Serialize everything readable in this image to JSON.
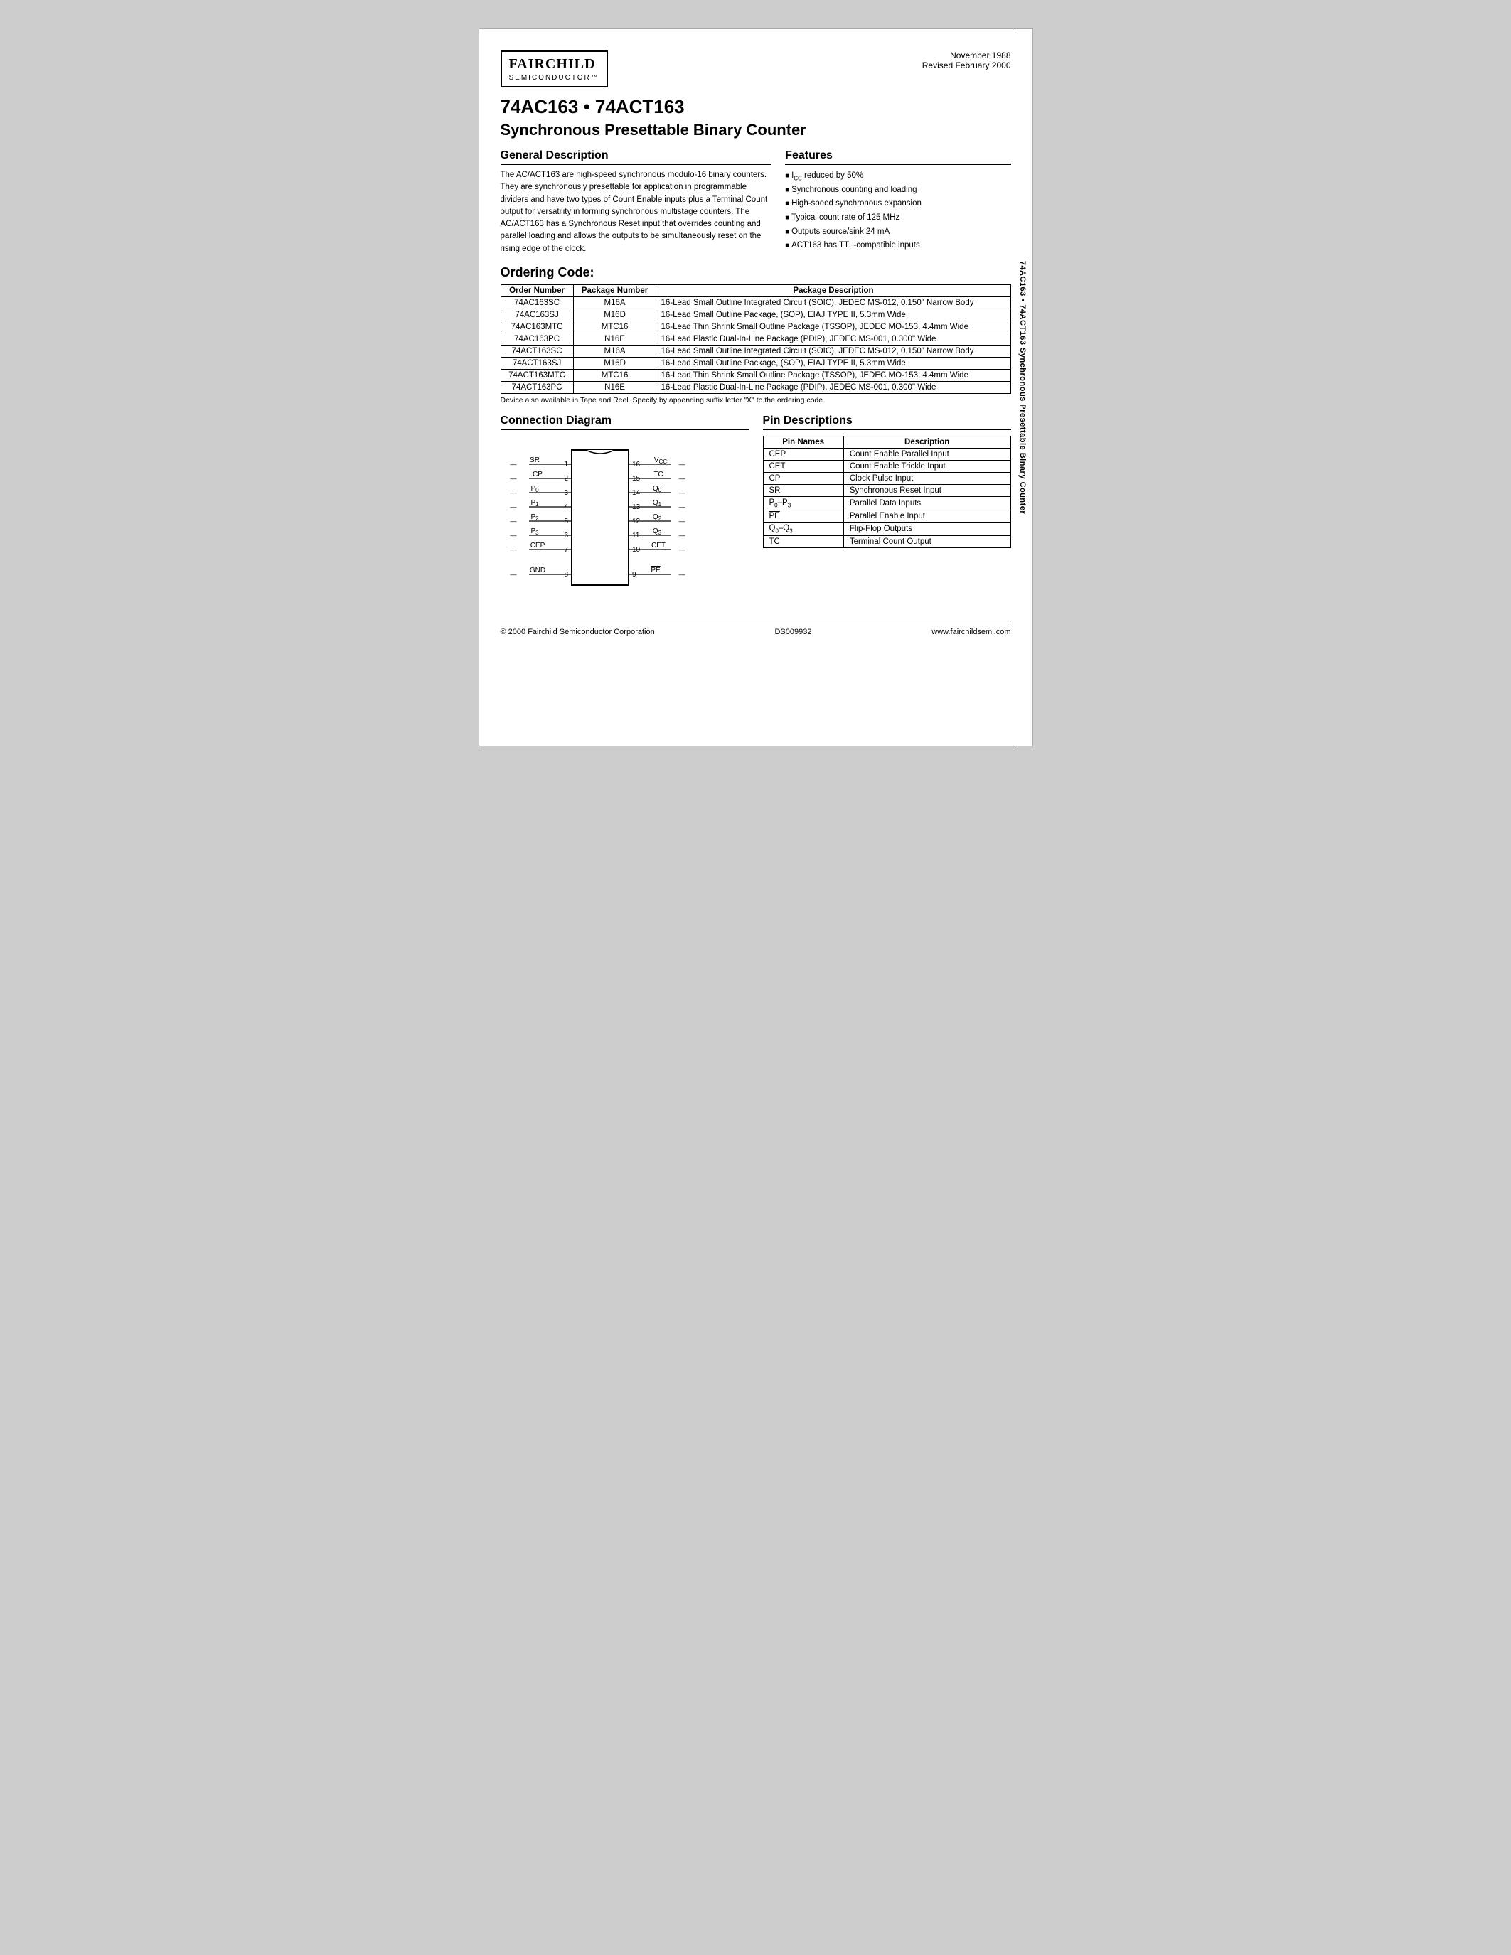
{
  "page": {
    "side_text": "74AC163 • 74ACT163 Synchronous Presettable Binary Counter",
    "date": "November 1988",
    "revised": "Revised February 2000",
    "logo": {
      "name": "FAIRCHILD",
      "sub": "SEMICONDUCTOR™"
    },
    "title": "74AC163 • 74ACT163",
    "subtitle": "Synchronous Presettable Binary Counter",
    "general_description": {
      "heading": "General Description",
      "text": "The AC/ACT163 are high-speed synchronous modulo-16 binary counters. They are synchronously presettable for application in programmable dividers and have two types of Count Enable inputs plus a Terminal Count output for versatility in forming synchronous multistage counters. The AC/ACT163 has a Synchronous Reset input that overrides counting and parallel loading and allows the outputs to be simultaneously reset on the rising edge of the clock."
    },
    "features": {
      "heading": "Features",
      "items": [
        "I_CC reduced by 50%",
        "Synchronous counting and loading",
        "High-speed synchronous expansion",
        "Typical count rate of 125 MHz",
        "Outputs source/sink 24 mA",
        "ACT163 has TTL-compatible inputs"
      ]
    },
    "ordering": {
      "heading": "Ordering Code:",
      "columns": [
        "Order Number",
        "Package Number",
        "Package Description"
      ],
      "rows": [
        [
          "74AC163SC",
          "M16A",
          "16-Lead Small Outline Integrated Circuit (SOIC), JEDEC MS-012, 0.150\" Narrow Body"
        ],
        [
          "74AC163SJ",
          "M16D",
          "16-Lead Small Outline Package, (SOP), EIAJ TYPE II, 5.3mm Wide"
        ],
        [
          "74AC163MTC",
          "MTC16",
          "16-Lead Thin Shrink Small Outline Package (TSSOP), JEDEC MO-153, 4.4mm Wide"
        ],
        [
          "74AC163PC",
          "N16E",
          "16-Lead Plastic Dual-In-Line Package (PDIP), JEDEC MS-001, 0.300\" Wide"
        ],
        [
          "74ACT163SC",
          "M16A",
          "16-Lead Small Outline Integrated Circuit (SOIC), JEDEC MS-012, 0.150\" Narrow Body"
        ],
        [
          "74ACT163SJ",
          "M16D",
          "16-Lead Small Outline Package, (SOP), EIAJ TYPE II, 5.3mm Wide"
        ],
        [
          "74ACT163MTC",
          "MTC16",
          "16-Lead Thin Shrink Small Outline Package (TSSOP), JEDEC MO-153, 4.4mm Wide"
        ],
        [
          "74ACT163PC",
          "N16E",
          "16-Lead Plastic Dual-In-Line Package (PDIP), JEDEC MS-001, 0.300\" Wide"
        ]
      ],
      "tape_note": "Device also available in Tape and Reel. Specify by appending suffix letter \"X\" to the ordering code."
    },
    "connection_diagram": {
      "heading": "Connection Diagram",
      "pins_left": [
        {
          "num": "1",
          "label": "SR",
          "overline": true
        },
        {
          "num": "2",
          "label": "CP",
          "overline": false
        },
        {
          "num": "3",
          "label": "P₀",
          "overline": false
        },
        {
          "num": "4",
          "label": "P₁",
          "overline": false
        },
        {
          "num": "5",
          "label": "P₂",
          "overline": false
        },
        {
          "num": "6",
          "label": "P₃",
          "overline": false
        },
        {
          "num": "7",
          "label": "CEP",
          "overline": false
        },
        {
          "num": "8",
          "label": "GND",
          "overline": false
        }
      ],
      "pins_right": [
        {
          "num": "16",
          "label": "V_CC",
          "overline": false
        },
        {
          "num": "15",
          "label": "TC",
          "overline": false
        },
        {
          "num": "14",
          "label": "Q₀",
          "overline": false
        },
        {
          "num": "13",
          "label": "Q₁",
          "overline": false
        },
        {
          "num": "12",
          "label": "Q₂",
          "overline": false
        },
        {
          "num": "11",
          "label": "Q₃",
          "overline": false
        },
        {
          "num": "10",
          "label": "CET",
          "overline": false
        },
        {
          "num": "9",
          "label": "PE",
          "overline": true
        }
      ]
    },
    "pin_descriptions": {
      "heading": "Pin Descriptions",
      "columns": [
        "Pin Names",
        "Description"
      ],
      "rows": [
        {
          "pin": "CEP",
          "overline": false,
          "desc": "Count Enable Parallel Input"
        },
        {
          "pin": "CET",
          "overline": false,
          "desc": "Count Enable Trickle Input"
        },
        {
          "pin": "CP",
          "overline": false,
          "desc": "Clock Pulse Input"
        },
        {
          "pin": "SR",
          "overline": true,
          "desc": "Synchronous Reset Input"
        },
        {
          "pin": "P₀–P₃",
          "overline": false,
          "desc": "Parallel Data Inputs"
        },
        {
          "pin": "PE",
          "overline": true,
          "desc": "Parallel Enable Input"
        },
        {
          "pin": "Q₀–Q₃",
          "overline": false,
          "desc": "Flip-Flop Outputs"
        },
        {
          "pin": "TC",
          "overline": false,
          "desc": "Terminal Count Output"
        }
      ]
    },
    "footer": {
      "copyright": "© 2000 Fairchild Semiconductor Corporation",
      "doc_number": "DS009932",
      "website": "www.fairchildsemi.com"
    }
  }
}
